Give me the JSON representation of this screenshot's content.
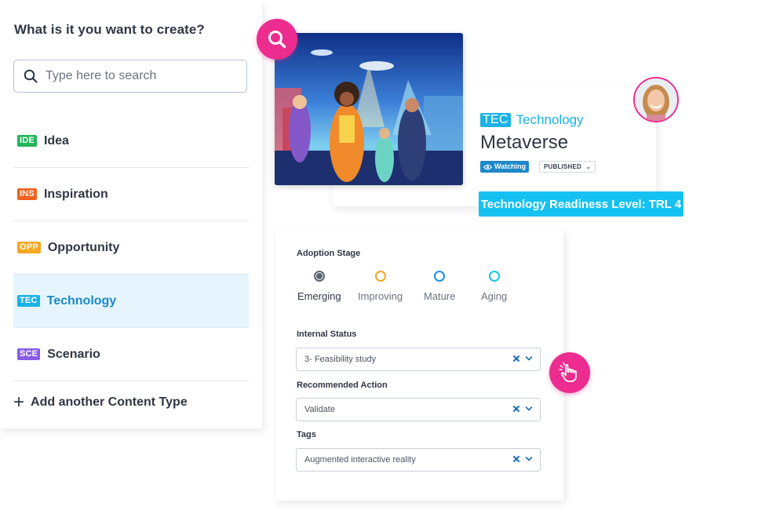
{
  "left_panel": {
    "title": "What is it you want to create?",
    "search_placeholder": "Type here to search",
    "items": [
      {
        "badge": "IDE",
        "label": "Idea",
        "color": "#22b55a"
      },
      {
        "badge": "INS",
        "label": "Inspiration",
        "color": "#f0621f"
      },
      {
        "badge": "OPP",
        "label": "Opportunity",
        "color": "#f6a623"
      },
      {
        "badge": "TEC",
        "label": "Technology",
        "color": "#19b3e6"
      },
      {
        "badge": "SCE",
        "label": "Scenario",
        "color": "#8a5ce6"
      }
    ],
    "selected_item": "Technology",
    "add_label": "Add another Content Type"
  },
  "card": {
    "type_badge": "TEC",
    "type_label": "Technology",
    "title": "Metaverse",
    "watching_label": "Watching",
    "published_label": "PUBLISHED",
    "trl_label": "Technology Readiness Level: TRL 4"
  },
  "form": {
    "adoption_label": "Adoption Stage",
    "stages": [
      {
        "name": "Emerging",
        "color": "#5b6470",
        "selected": true
      },
      {
        "name": "Improving",
        "color": "#f6a623",
        "selected": false
      },
      {
        "name": "Mature",
        "color": "#1e8fe0",
        "selected": false
      },
      {
        "name": "Aging",
        "color": "#19c3e6",
        "selected": false
      }
    ],
    "internal_status_label": "Internal Status",
    "internal_status_value": "3- Feasibility study",
    "recommended_action_label": "Recommended Action",
    "recommended_action_value": "Validate",
    "tags_label": "Tags",
    "tags_value": "Augmented interactive reality"
  },
  "colors": {
    "accent_pink": "#ec2c8e",
    "accent_blue": "#1a89c8",
    "trl_blue": "#15c1f1"
  }
}
